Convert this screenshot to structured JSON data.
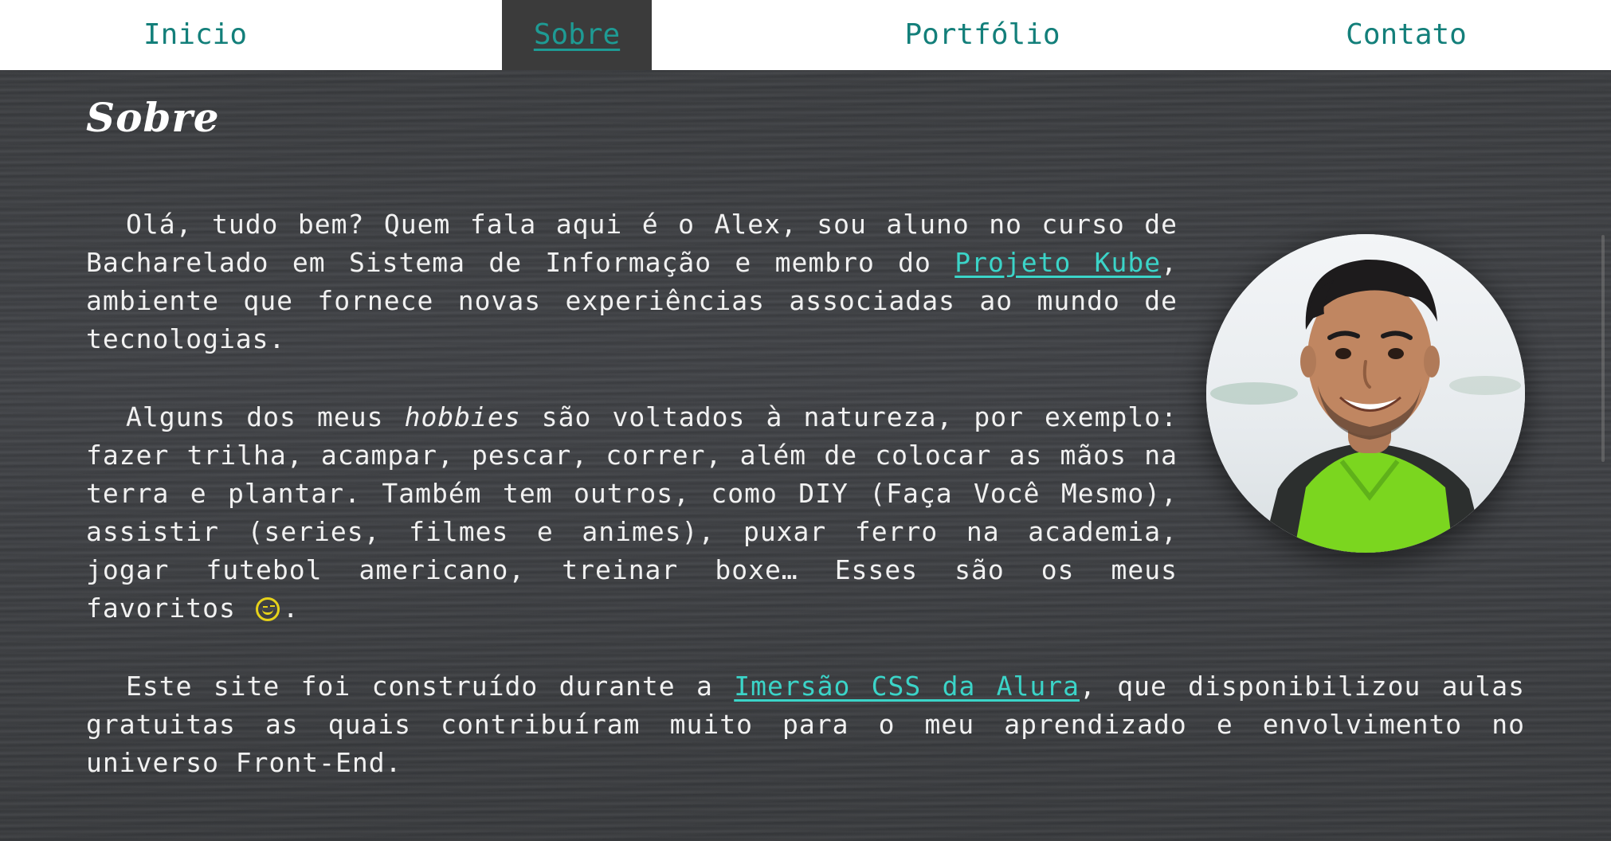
{
  "nav": {
    "items": [
      {
        "label": "Inicio"
      },
      {
        "label": "Sobre"
      },
      {
        "label": "Portfólio"
      },
      {
        "label": "Contato"
      }
    ]
  },
  "page": {
    "title": "Sobre"
  },
  "about": {
    "p1": {
      "before": "Olá, tudo bem? Quem fala aqui é o Alex, sou aluno no curso de Bacharelado em Sistema de Informação e membro do ",
      "link": "Projeto Kube",
      "after": ", ambiente que fornece novas experiências associadas ao mundo de tecnologias."
    },
    "p2": {
      "before": "Alguns dos meus ",
      "emphasis": "hobbies",
      "after": " são voltados à natureza, por exemplo: fazer trilha, acampar, pescar, correr, além de colocar as mãos na terra e plantar. Também tem outros, como DIY (Faça Você Mesmo), assistir (series, filmes e animes), puxar ferro na academia, jogar futebol americano, treinar boxe… Esses são os meus favoritos",
      "end": "."
    },
    "p3": {
      "before": "Este site foi construído durante a ",
      "link": "Imersão CSS da Alura",
      "after": ", que disponibilizou aulas gratuitas as quais contribuíram muito para o meu aprendizado e envolvimento no universo Front-End."
    }
  },
  "colors": {
    "accent": "#137f7a",
    "link": "#3bd4c8",
    "emoji": "#e6d21a",
    "background": "#3b3d40"
  },
  "icons": {
    "emoji": "wink-face-icon"
  }
}
